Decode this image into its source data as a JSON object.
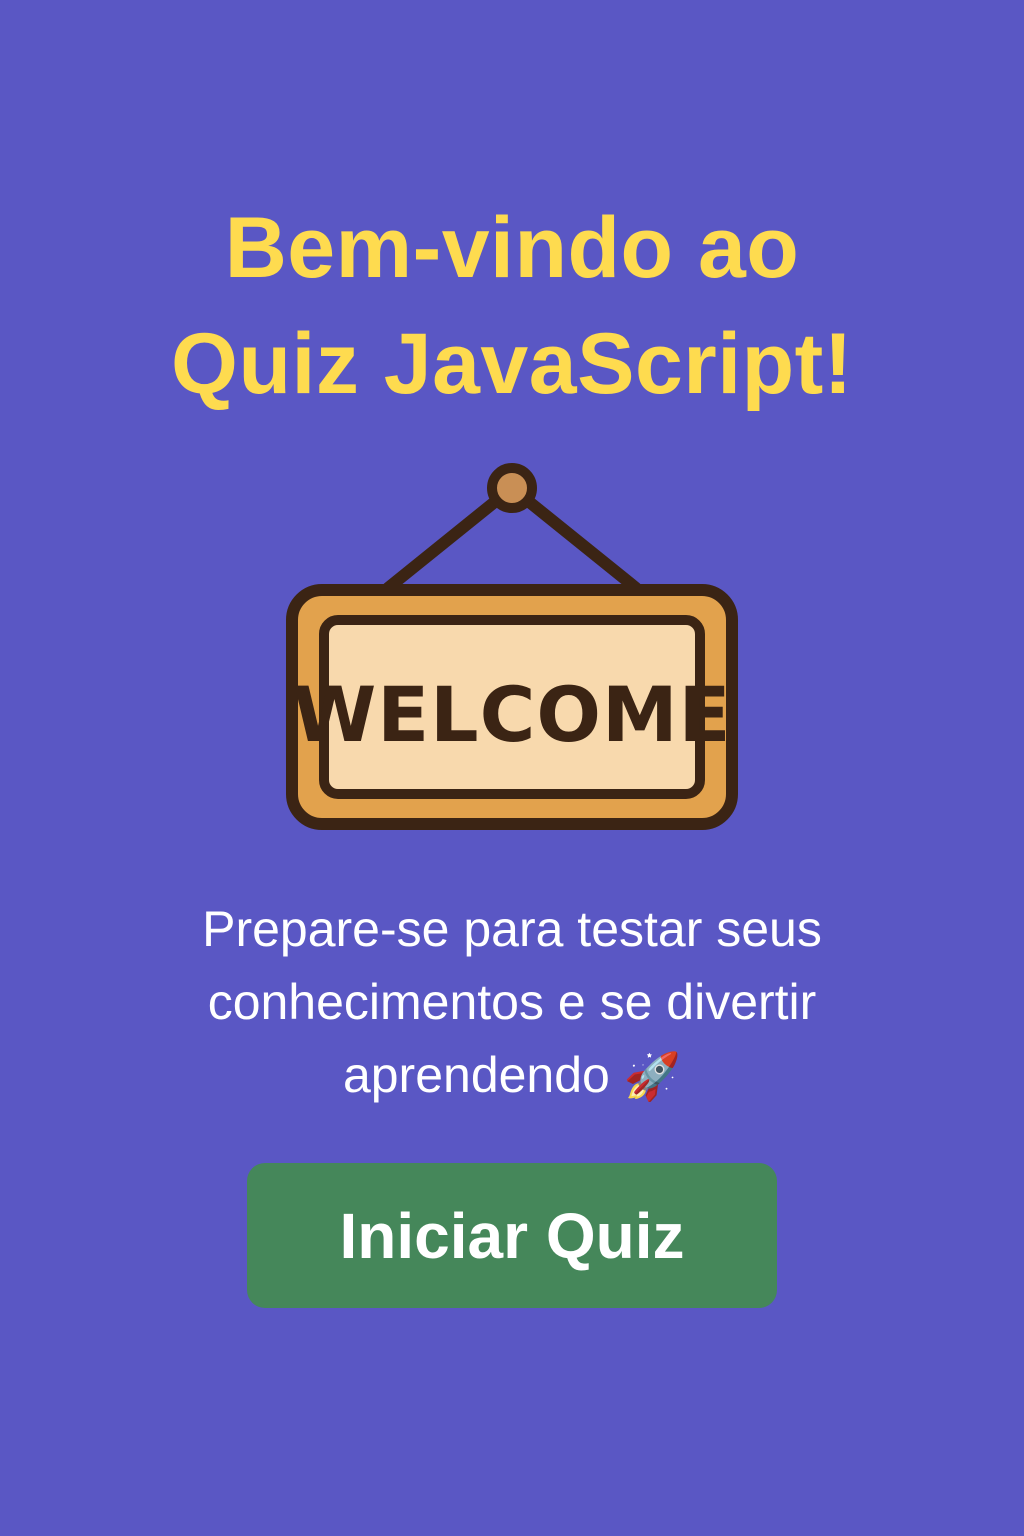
{
  "header": {
    "title_line1": "Bem-vindo ao",
    "title_line2": "Quiz JavaScript!"
  },
  "sign": {
    "text": "WELCOME",
    "icon": "welcome-sign-icon"
  },
  "subtitle": {
    "line1": "Prepare-se para testar seus",
    "line2": "conhecimentos e se divertir",
    "line3": "aprendendo",
    "emoji": "🚀"
  },
  "start_button": {
    "label": "Iniciar Quiz"
  },
  "colors": {
    "background": "#5a57c4",
    "title": "#fedb4f",
    "button": "#45875a",
    "text": "#ffffff"
  }
}
